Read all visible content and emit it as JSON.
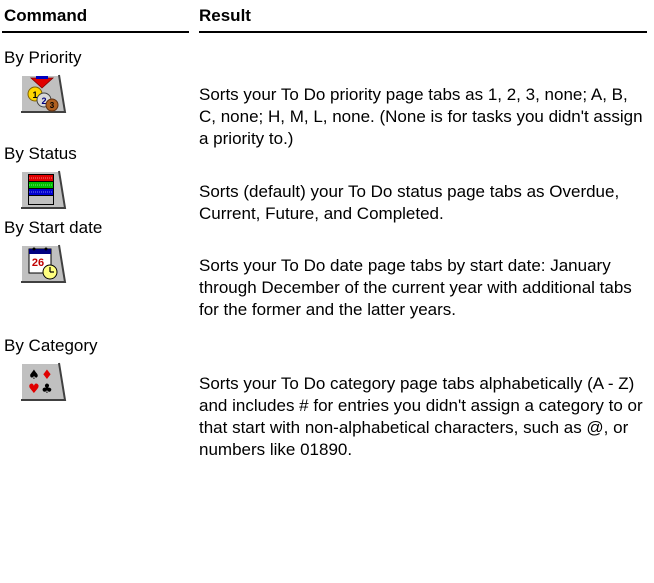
{
  "header": {
    "command": "Command",
    "result": "Result"
  },
  "rows": [
    {
      "label": "By Priority",
      "icon": "priority-icon",
      "result": "Sorts your To Do priority page tabs as 1, 2, 3, none; A, B, C, none; H, M, L, none. (None is for tasks you didn't assign a priority to.)"
    },
    {
      "label": "By Status",
      "icon": "status-bars-icon",
      "result": "Sorts (default) your To Do status page tabs as Overdue, Current, Future, and Completed."
    },
    {
      "label": "By Start date",
      "icon": "calendar-clock-icon",
      "icon_text": "26",
      "result": "Sorts your To Do date page tabs by start date: January through December of the current year with additional tabs for the former and the latter years."
    },
    {
      "label": "By Category",
      "icon": "card-suits-icon",
      "result": "Sorts your To Do category page tabs alphabetically (A - Z) and includes # for entries you didn't assign a category to or that start with non-alphabetical characters, such as @, or numbers like 01890."
    }
  ]
}
